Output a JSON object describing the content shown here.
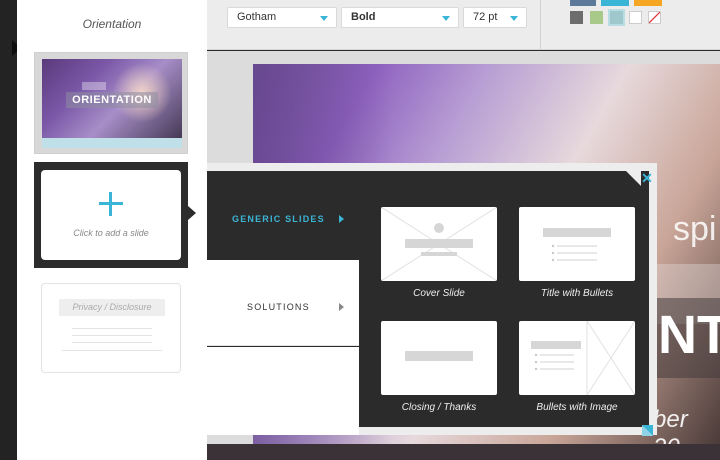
{
  "colors": {
    "accent": "#3bb5d6",
    "popup_bg": "#2b2b2b",
    "panel_bg": "#ffffff"
  },
  "sidebar": {
    "current_slide_label": "Orientation",
    "thumbnail": {
      "title": "ORIENTATION"
    },
    "add_slide_hint": "Click to add a slide",
    "privacy_card_label": "Privacy / Disclosure"
  },
  "toolbar": {
    "font_family": "Gotham",
    "font_weight": "Bold",
    "font_size": "72 pt",
    "swatch_colors": [
      "#6d6d6d",
      "#a9c98a",
      "#9fc8cc",
      "#ffffff"
    ]
  },
  "slide": {
    "fragment_right": "spi",
    "fragment_big": "NT",
    "fragment_date": "ber 20"
  },
  "template_picker": {
    "categories": [
      {
        "label": "GENERIC SLIDES",
        "active": true
      },
      {
        "label": "SOLUTIONS",
        "active": false
      }
    ],
    "templates": [
      {
        "name": "Cover Slide",
        "icon": "cover-slide-icon"
      },
      {
        "name": "Title with Bullets",
        "icon": "title-bullets-icon"
      },
      {
        "name": "Closing / Thanks",
        "icon": "closing-icon"
      },
      {
        "name": "Bullets with Image",
        "icon": "bullets-image-icon"
      }
    ],
    "close_icon": "close-icon",
    "resize_icon": "resize-handle-icon"
  }
}
